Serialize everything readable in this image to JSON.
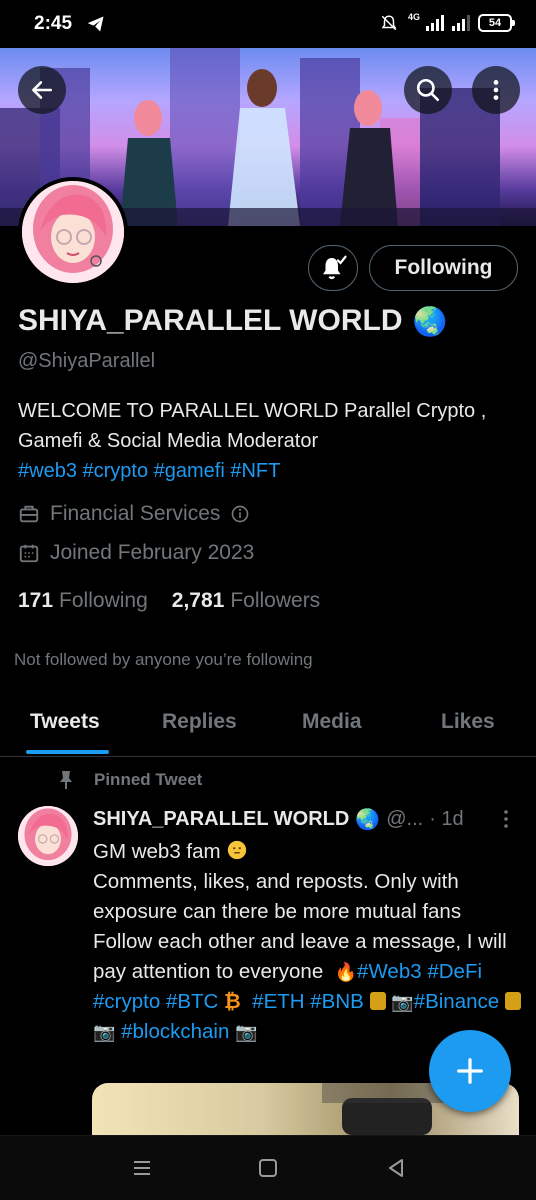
{
  "status_bar": {
    "time": "2:45",
    "network": "4G",
    "battery": "54",
    "icons": [
      "telegram-icon",
      "mute-icon",
      "signal-icon",
      "battery-icon"
    ]
  },
  "header": {
    "icons": [
      "back-arrow-icon",
      "search-icon",
      "more-vertical-icon"
    ]
  },
  "profile": {
    "display_name": "SHIYA_PARALLEL WORLD",
    "name_emoji": "🌏",
    "handle": "@ShiyaParallel",
    "bio_text": "WELCOME TO PARALLEL WORLD Parallel Crypto , Gamefi & Social Media Moderator",
    "bio_hashtags": "#web3 #crypto #gamefi #NFT",
    "category": "Financial Services",
    "joined": "Joined February 2023",
    "following_count": "171",
    "following_label": "Following",
    "followers_count": "2,781",
    "followers_label": "Followers",
    "not_followed_text": "Not followed by anyone you’re following",
    "following_button": "Following"
  },
  "tabs": [
    {
      "label": "Tweets",
      "active": true
    },
    {
      "label": "Replies",
      "active": false
    },
    {
      "label": "Media",
      "active": false
    },
    {
      "label": "Likes",
      "active": false
    }
  ],
  "pinned_tweet": {
    "pinned_label": "Pinned Tweet",
    "author_name": "SHIYA_PARALLEL WORLD",
    "author_emoji": "🌏",
    "author_handle": "@...",
    "time": "· 1d",
    "line1_text": "GM web3 fam",
    "line2": "Comments, likes, and reposts. Only with exposure can there be more mutual fans Follow each other and leave a message, I will pay attention to everyone",
    "fire_emoji": "🔥",
    "tag_web3": "#Web3",
    "tag_defi": "#DeFi",
    "tag_crypto": "#crypto",
    "tag_btc": "#BTC",
    "btc_emoji": "₿",
    "tag_eth": "#ETH",
    "tag_bnb": "#BNB",
    "camera_emoji": "📷",
    "tag_binance": "#Binance",
    "tag_blockchain": "#blockchain"
  },
  "nav": {
    "icons": [
      "recent-apps-icon",
      "home-icon",
      "back-icon"
    ]
  },
  "colors": {
    "accent": "#1d9bf0",
    "secondary_text": "#71767b",
    "background": "#000000"
  }
}
